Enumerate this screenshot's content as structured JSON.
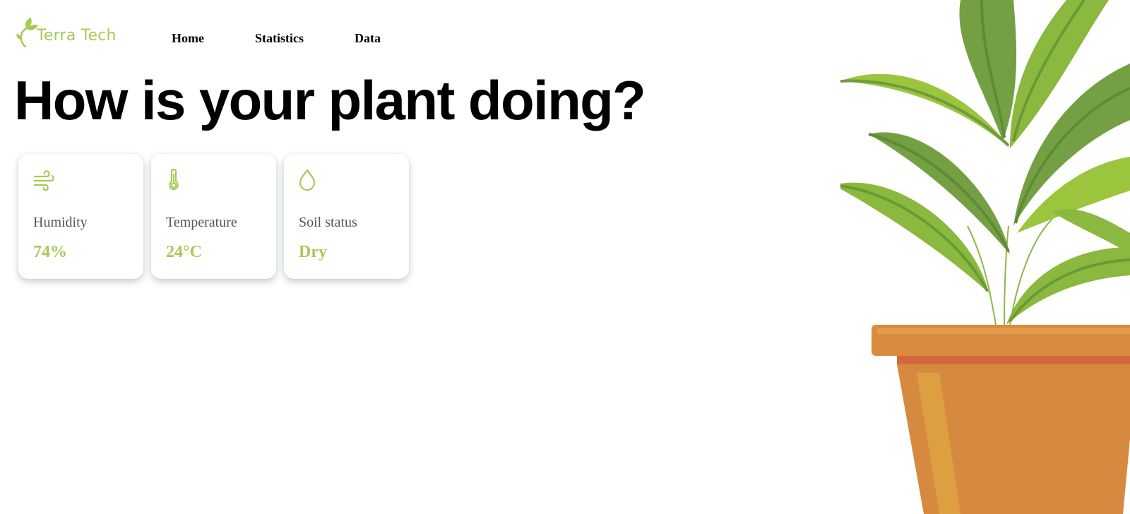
{
  "brand": {
    "name": "Terra Tech",
    "logo_icon": "leaf-sprout-icon",
    "color": "#a7c957"
  },
  "nav": {
    "items": [
      "Home",
      "Statistics",
      "Data"
    ]
  },
  "hero": {
    "title": "How is your plant doing?"
  },
  "cards": [
    {
      "icon": "wind-icon",
      "label": "Humidity",
      "value": "74%"
    },
    {
      "icon": "thermometer-icon",
      "label": "Temperature",
      "value": "24°C"
    },
    {
      "icon": "water-drop-icon",
      "label": "Soil status",
      "value": "Dry"
    }
  ],
  "colors": {
    "accent": "#a7c957",
    "leaf_dark": "#6f9a3e",
    "leaf_light": "#9bc53d",
    "pot": "#d58a3f",
    "pot_rim": "#d98c40",
    "pot_band": "#d4683c"
  }
}
